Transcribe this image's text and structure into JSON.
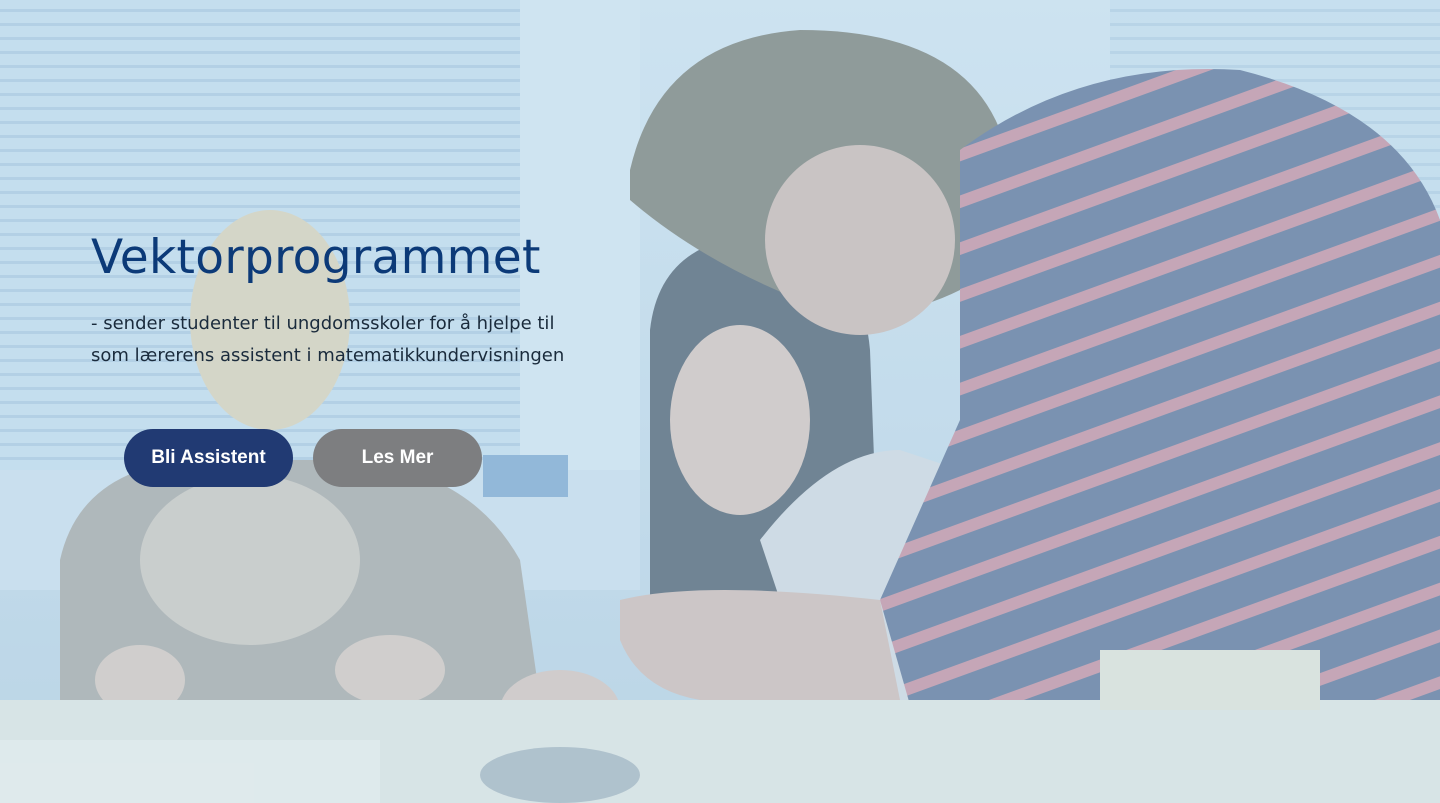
{
  "hero": {
    "title": "Vektorprogrammet",
    "subtitle": "- sender studenter til ungdomsskoler for å hjelpe til som lærerens assistent i matematikkundervisningen",
    "buttons": {
      "primary_label": "Bli Assistent",
      "secondary_label": "Les Mer"
    }
  },
  "colors": {
    "title": "#0c3a78",
    "primary_button": "#213a73",
    "secondary_button": "#7d7e80",
    "overlay_tint": "#bedcf0"
  }
}
